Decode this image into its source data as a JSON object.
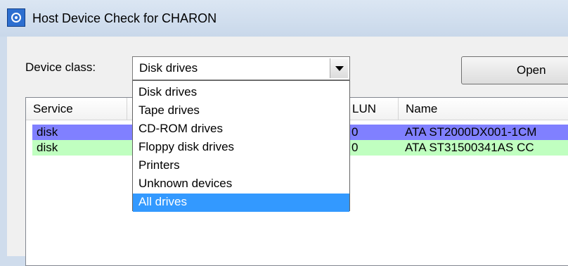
{
  "window": {
    "title": "Host Device Check for CHARON",
    "icon": "charon-app-icon",
    "accent": "#2d6fd0"
  },
  "toolbar": {
    "device_class_label": "Device class:",
    "device_class_value": "Disk drives",
    "open_label": "Open"
  },
  "dropdown": {
    "options": [
      "Disk drives",
      "Tape drives",
      "CD-ROM drives",
      "Floppy disk drives",
      "Printers",
      "Unknown devices",
      "All drives"
    ],
    "highlighted": "All drives",
    "highlight_color": "#3399ff"
  },
  "table": {
    "columns": [
      "Service",
      "",
      "LUN",
      "Name"
    ],
    "rows": [
      {
        "service": "disk",
        "lun": "0",
        "name": "ATA ST2000DX001-1CM",
        "color": "#8080ff"
      },
      {
        "service": "disk",
        "lun": "0",
        "name": "ATA ST31500341AS CC",
        "color": "#c0ffc0"
      }
    ]
  }
}
